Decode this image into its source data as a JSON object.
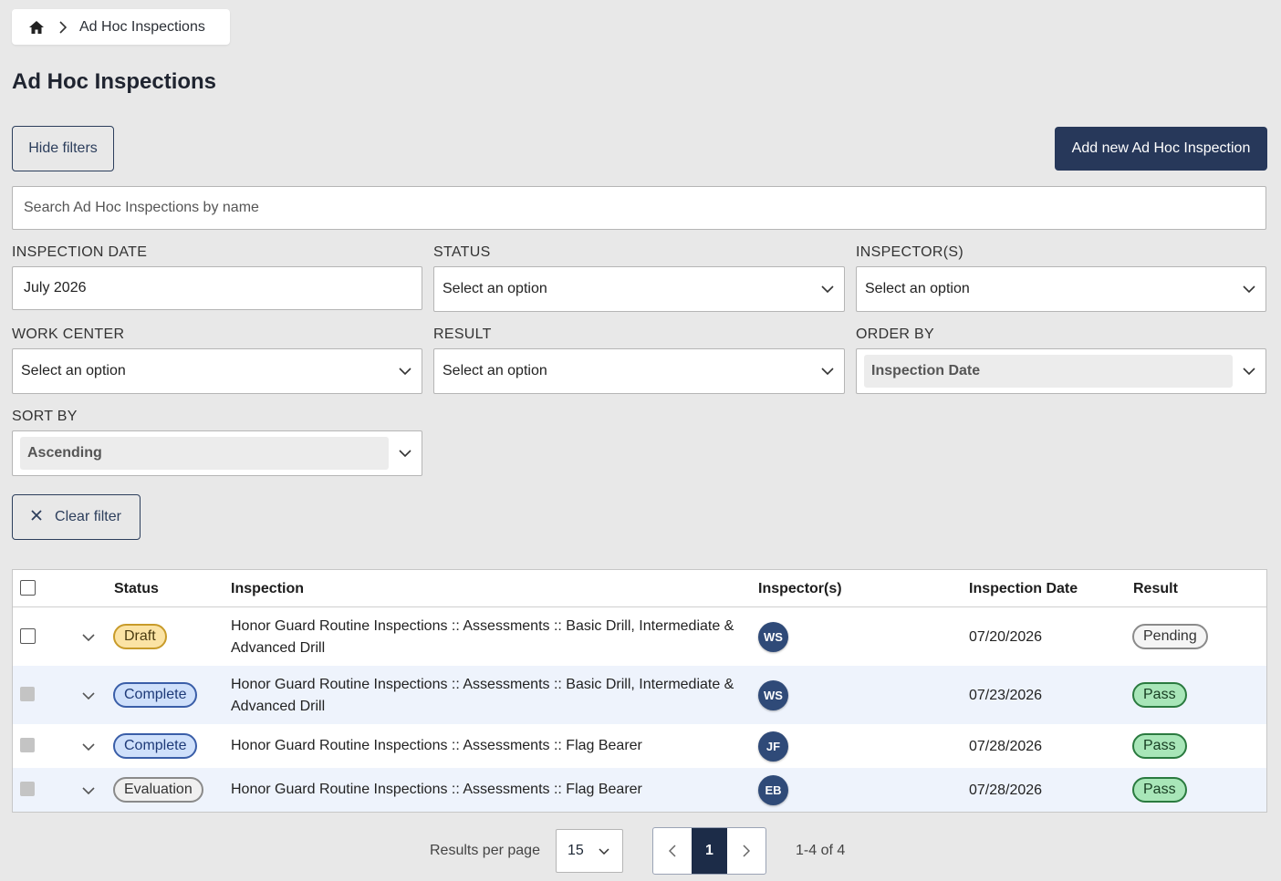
{
  "breadcrumb": {
    "home_icon": "home-icon",
    "current": "Ad Hoc Inspections"
  },
  "page": {
    "title": "Ad Hoc Inspections"
  },
  "actions": {
    "hide_filters": "Hide filters",
    "add_new": "Add new Ad Hoc Inspection",
    "clear_filter": "Clear filter"
  },
  "search": {
    "placeholder": "Search Ad Hoc Inspections by name",
    "value": ""
  },
  "filters": {
    "inspection_date": {
      "label": "INSPECTION DATE",
      "value": "July 2026"
    },
    "status": {
      "label": "STATUS",
      "value": "Select an option"
    },
    "inspectors": {
      "label": "INSPECTOR(S)",
      "value": "Select an option"
    },
    "work_center": {
      "label": "WORK CENTER",
      "value": "Select an option"
    },
    "result": {
      "label": "RESULT",
      "value": "Select an option"
    },
    "order_by": {
      "label": "ORDER BY",
      "value": "Inspection Date"
    },
    "sort_by": {
      "label": "SORT BY",
      "value": "Ascending"
    }
  },
  "table": {
    "columns": [
      "Status",
      "Inspection",
      "Inspector(s)",
      "Inspection Date",
      "Result"
    ],
    "rows": [
      {
        "status": "Draft",
        "inspection_line1": "Honor Guard Routine Inspections :: Assessments :: Basic Drill, Intermediate &",
        "inspection_line2": "Advanced Drill",
        "inspector": "WS",
        "date": "07/20/2026",
        "result": "Pending"
      },
      {
        "status": "Complete",
        "inspection_line1": "Honor Guard Routine Inspections :: Assessments :: Basic Drill, Intermediate &",
        "inspection_line2": "Advanced Drill",
        "inspector": "WS",
        "date": "07/23/2026",
        "result": "Pass"
      },
      {
        "status": "Complete",
        "inspection_line1": "Honor Guard Routine Inspections :: Assessments :: Flag Bearer",
        "inspection_line2": "",
        "inspector": "JF",
        "date": "07/28/2026",
        "result": "Pass"
      },
      {
        "status": "Evaluation",
        "inspection_line1": "Honor Guard Routine Inspections :: Assessments :: Flag Bearer",
        "inspection_line2": "",
        "inspector": "EB",
        "date": "07/28/2026",
        "result": "Pass"
      }
    ]
  },
  "pagination": {
    "results_per_page_label": "Results per page",
    "per_page": "15",
    "current_page": "1",
    "range": "1-4 of 4"
  },
  "colors": {
    "primary": "#27385a",
    "draft": "#fbe3a4",
    "complete": "#cfe0fb",
    "pass": "#a8e6b8",
    "alt_row": "#eef3fc"
  }
}
